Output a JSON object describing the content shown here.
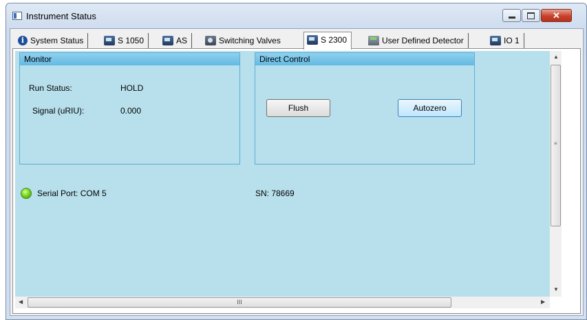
{
  "window": {
    "title": "Instrument Status",
    "close_glyph": "✕"
  },
  "tabs": [
    {
      "label": "System Status",
      "icon": "info-icon",
      "active": false
    },
    {
      "label": "S 1050",
      "icon": "device-icon",
      "active": false
    },
    {
      "label": "AS",
      "icon": "autosampler-icon",
      "active": false
    },
    {
      "label": "Switching Valves",
      "icon": "valve-icon",
      "active": false
    },
    {
      "label": "S 2300",
      "icon": "device-icon",
      "active": true
    },
    {
      "label": "User Defined Detector",
      "icon": "detector-icon",
      "active": false
    },
    {
      "label": "IO 1",
      "icon": "device-icon",
      "active": false
    }
  ],
  "monitor": {
    "title": "Monitor",
    "run_status_label": "Run Status:",
    "run_status_value": "HOLD",
    "signal_label": "Signal (uRIU):",
    "signal_value": "0.000"
  },
  "direct_control": {
    "title": "Direct Control",
    "flush_label": "Flush",
    "autozero_label": "Autozero"
  },
  "status": {
    "serial_port": "Serial Port: COM  5",
    "serial_number": "SN:  78669",
    "connection_color": "#7cd621"
  },
  "scroll": {
    "grip": "≡",
    "hgrip": "III"
  },
  "colors": {
    "pane_bg": "#b8e0ec",
    "group_header": "#63b9e2"
  }
}
